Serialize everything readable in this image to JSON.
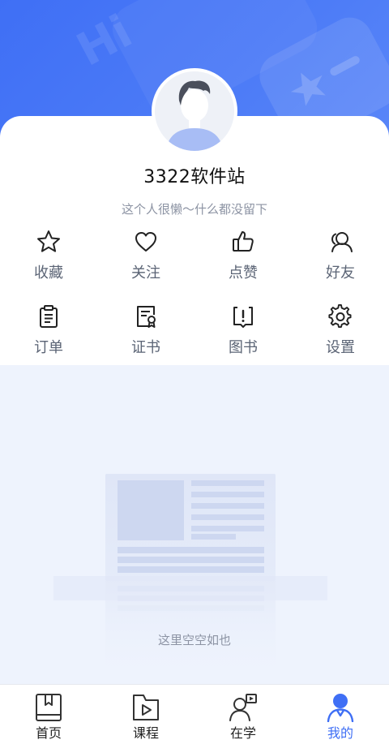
{
  "hero": {
    "decoration_text": "Hi"
  },
  "profile": {
    "username": "3322软件站",
    "bio": "这个人很懒～什么都没留下"
  },
  "menu": [
    {
      "label": "收藏",
      "icon": "star-icon"
    },
    {
      "label": "关注",
      "icon": "heart-icon"
    },
    {
      "label": "点赞",
      "icon": "thumbs-up-icon"
    },
    {
      "label": "好友",
      "icon": "friends-icon"
    },
    {
      "label": "订单",
      "icon": "clipboard-icon"
    },
    {
      "label": "证书",
      "icon": "certificate-icon"
    },
    {
      "label": "图书",
      "icon": "book-icon"
    },
    {
      "label": "设置",
      "icon": "gear-icon"
    }
  ],
  "empty": {
    "text": "这里空空如也"
  },
  "tabs": [
    {
      "label": "首页",
      "icon": "home-book-icon",
      "active": false
    },
    {
      "label": "课程",
      "icon": "course-play-icon",
      "active": false
    },
    {
      "label": "在学",
      "icon": "learning-icon",
      "active": false
    },
    {
      "label": "我的",
      "icon": "profile-icon",
      "active": true
    }
  ],
  "colors": {
    "accent": "#3f6ff5",
    "header_blue": "#4d7cf7",
    "background": "#eef3fd",
    "label_gray": "#5b6475",
    "muted_text": "#8c93a3"
  }
}
